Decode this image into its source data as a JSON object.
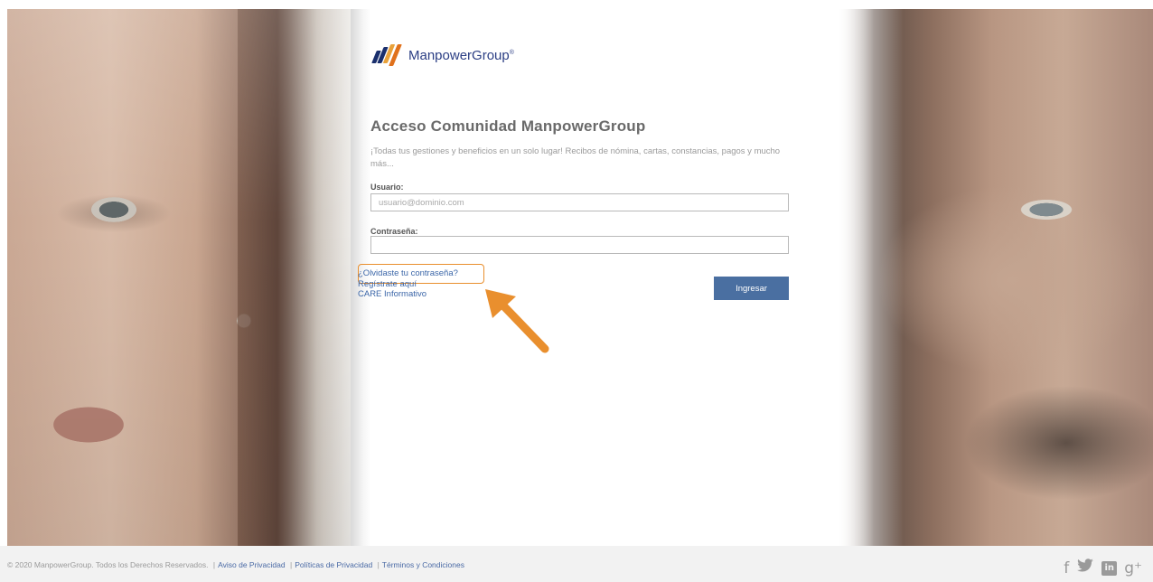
{
  "brand": {
    "name": "ManpowerGroup",
    "trademark": "®",
    "logo_color": "#1a2f6d",
    "accent_color": "#4a6fa1"
  },
  "login": {
    "title": "Acceso Comunidad ManpowerGroup",
    "subtitle": "¡Todas tus gestiones y beneficios en un solo lugar! Recibos de nómina, cartas, constancias, pagos y mucho más...",
    "user_label": "Usuario:",
    "user_placeholder": "usuario@dominio.com",
    "user_value": "",
    "password_label": "Contraseña:",
    "password_value": "",
    "submit_label": "Ingresar",
    "links": {
      "forgot": "¿Olvidaste tu contraseña?",
      "register": "Regístrate aquí",
      "care": "CARE Informativo"
    }
  },
  "annotation": {
    "highlight_color": "#e98f2e",
    "arrow_icon": "arrow-up-left-icon"
  },
  "footer": {
    "copyright": "© 2020 ManpowerGroup. Todos los Derechos Reservados.",
    "links": [
      "Aviso de Privacidad",
      "Políticas de Privacidad",
      "Términos y Condiciones"
    ],
    "social_icons": [
      "facebook-icon",
      "twitter-icon",
      "linkedin-icon",
      "google-plus-icon"
    ],
    "social_glyphs": [
      "f",
      "🐦",
      "in",
      "g⁺"
    ]
  }
}
